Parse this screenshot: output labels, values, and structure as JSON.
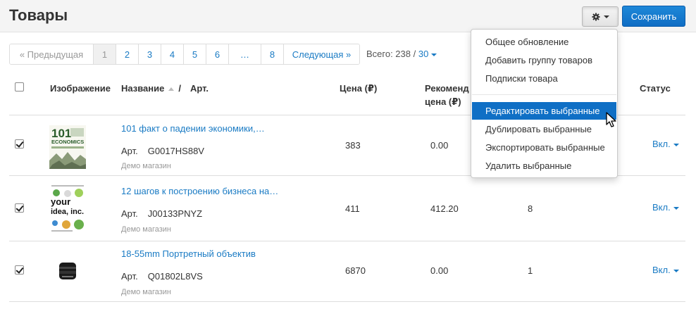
{
  "header": {
    "title": "Товары",
    "save_label": "Сохранить"
  },
  "pagination": {
    "prev_label": "« Предыдущая",
    "pages": [
      "1",
      "2",
      "3",
      "4",
      "5",
      "6",
      "…",
      "8"
    ],
    "active_page": "1",
    "next_label": "Следующая »",
    "total_label": "Всего: 238 /",
    "per_page": "30"
  },
  "table": {
    "headers": {
      "image": "Изображение",
      "name": "Название",
      "slash": "/",
      "sku": "Арт.",
      "price": "Цена (₽)",
      "recommended_line1": "Рекоменд",
      "recommended_line2": "цена (₽)",
      "status": "Статус"
    },
    "rows": [
      {
        "name": "101 факт о падении экономики,…",
        "sku_label": "Арт.",
        "sku": "G0017HS88V",
        "shop": "Демо магазин",
        "price": "383",
        "recommended": "0.00",
        "qty": "",
        "status": "Вкл.",
        "checked": true
      },
      {
        "name": "12 шагов к построению бизнеса на…",
        "sku_label": "Арт.",
        "sku": "J00133PNYZ",
        "shop": "Демо магазин",
        "price": "411",
        "recommended": "412.20",
        "qty": "8",
        "status": "Вкл.",
        "checked": true
      },
      {
        "name": "18-55mm Портретный объектив",
        "sku_label": "Арт.",
        "sku": "Q01802L8VS",
        "shop": "Демо магазин",
        "price": "6870",
        "recommended": "0.00",
        "qty": "1",
        "status": "Вкл.",
        "checked": true
      }
    ]
  },
  "thumbs": {
    "book1_big": "101",
    "book1_small": "ECONOMICS",
    "book2_line1": "your",
    "book2_line2": "idea, inc."
  },
  "dropdown": {
    "items": [
      "Общее обновление",
      "Добавить группу товаров",
      "Подписки товара",
      "Редактировать выбранные",
      "Дублировать выбранные",
      "Экспортировать выбранные",
      "Удалить выбранные"
    ],
    "active_index": 3
  },
  "colors": {
    "accent": "#1a7bc4",
    "save_button": "#1e88d8",
    "menu_highlight": "#0f6fc5"
  },
  "icons": {
    "settings": "gear-icon",
    "pointer": "cursor-arrow-icon"
  }
}
